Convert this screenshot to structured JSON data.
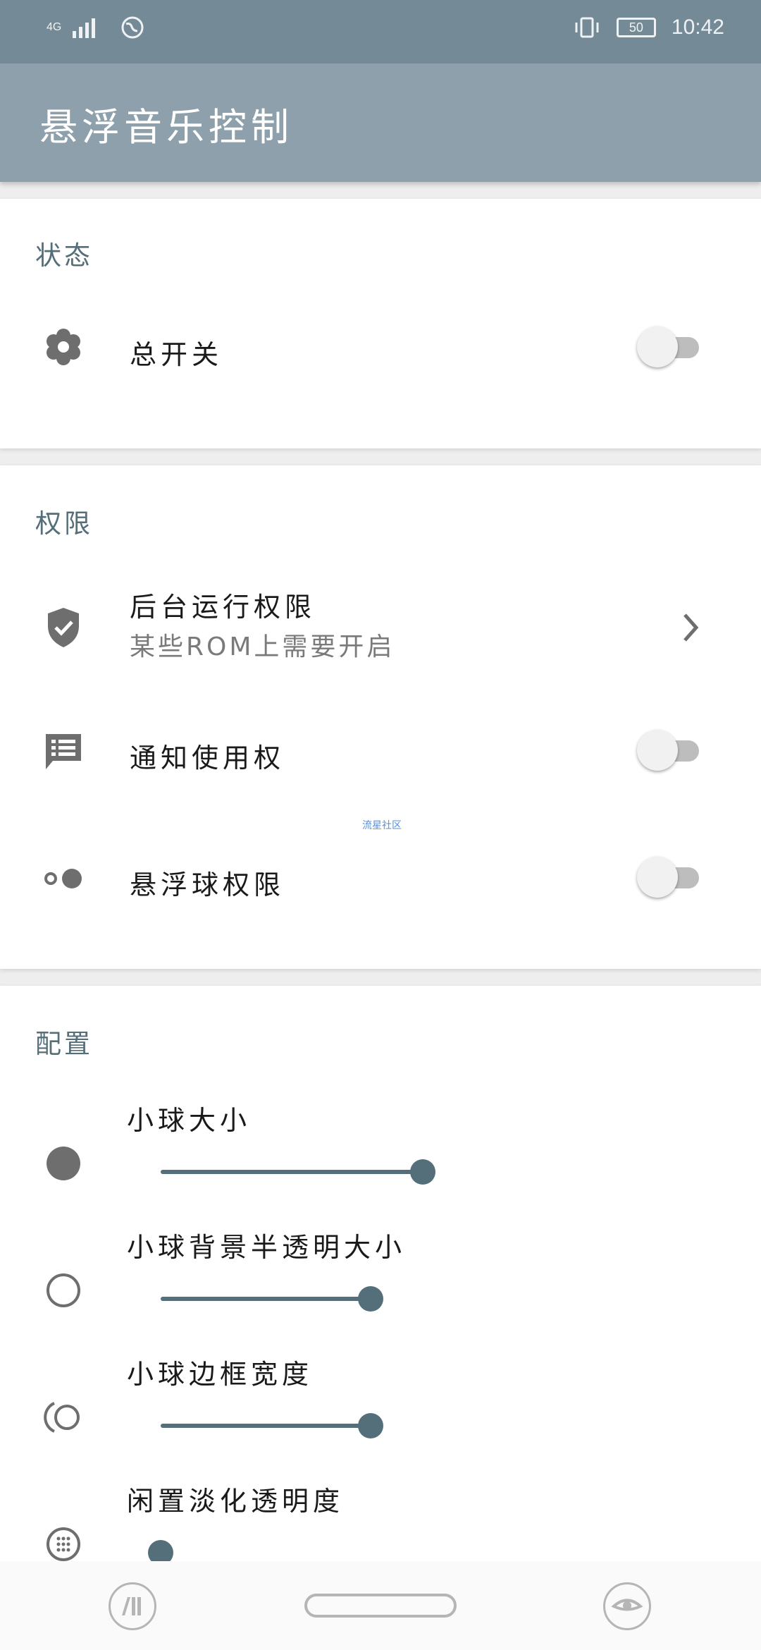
{
  "status_bar": {
    "network": "4G",
    "battery": "50",
    "time": "10:42"
  },
  "app_bar": {
    "title": "悬浮音乐控制"
  },
  "sections": {
    "status": {
      "title": "状态",
      "master_switch": {
        "label": "总开关",
        "checked": false
      }
    },
    "permissions": {
      "title": "权限",
      "background": {
        "label": "后台运行权限",
        "subtitle": "某些ROM上需要开启"
      },
      "notification": {
        "label": "通知使用权",
        "checked": false
      },
      "float_ball": {
        "label": "悬浮球权限",
        "checked": false
      }
    },
    "config": {
      "title": "配置",
      "ball_size": {
        "label": "小球大小",
        "value": 1.0
      },
      "bg_size": {
        "label": "小球背景半透明大小",
        "value": 0.8
      },
      "border_width": {
        "label": "小球边框宽度",
        "value": 0.8
      },
      "idle_alpha": {
        "label": "闲置淡化透明度",
        "value": 0.0
      }
    }
  },
  "watermark": "流星社区",
  "colors": {
    "accent": "#546e7a",
    "app_bar": "#8ea0ab",
    "status_bar": "#758a97"
  }
}
